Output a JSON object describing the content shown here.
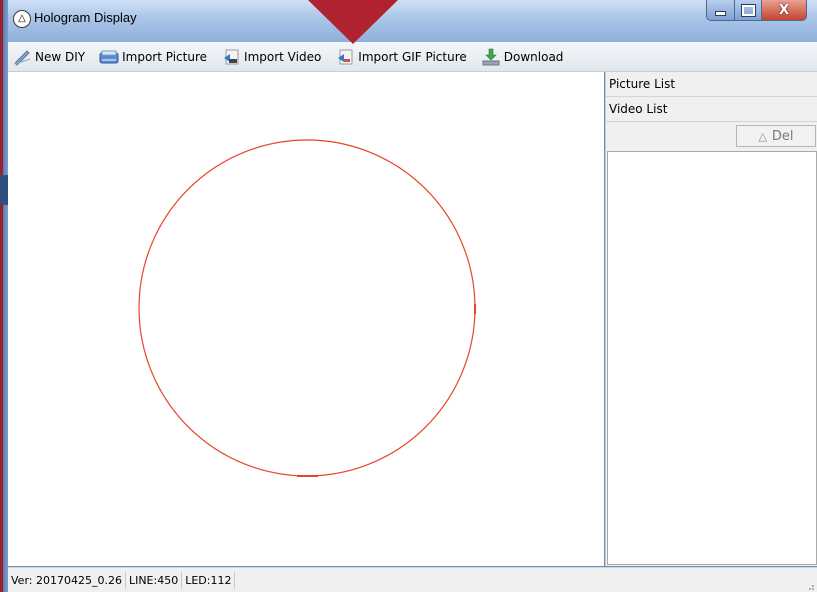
{
  "window": {
    "title": "Hologram Display",
    "controls": {
      "minimize": "–",
      "maximize": "□",
      "close": "X"
    }
  },
  "toolbar": {
    "items": [
      {
        "label": "New DIY",
        "icon": "pen-icon"
      },
      {
        "label": "Import Picture",
        "icon": "scanner-icon"
      },
      {
        "label": "Import Video",
        "icon": "video-import-icon"
      },
      {
        "label": "Import GIF Picture",
        "icon": "gif-import-icon"
      },
      {
        "label": "Download",
        "icon": "download-icon"
      }
    ]
  },
  "canvas": {
    "shape": "circle",
    "stroke_color": "#e8442a"
  },
  "side_panel": {
    "picture_list_label": "Picture List",
    "video_list_label": "Video List",
    "delete_button_label": "Del"
  },
  "status": {
    "version": "Ver: 20170425_0.26",
    "line": "LINE:450",
    "led": "LED:112"
  },
  "colors": {
    "accent_arrow": "#b0222f",
    "title_bar": "#a9c4e7",
    "close_button": "#c5442f"
  }
}
